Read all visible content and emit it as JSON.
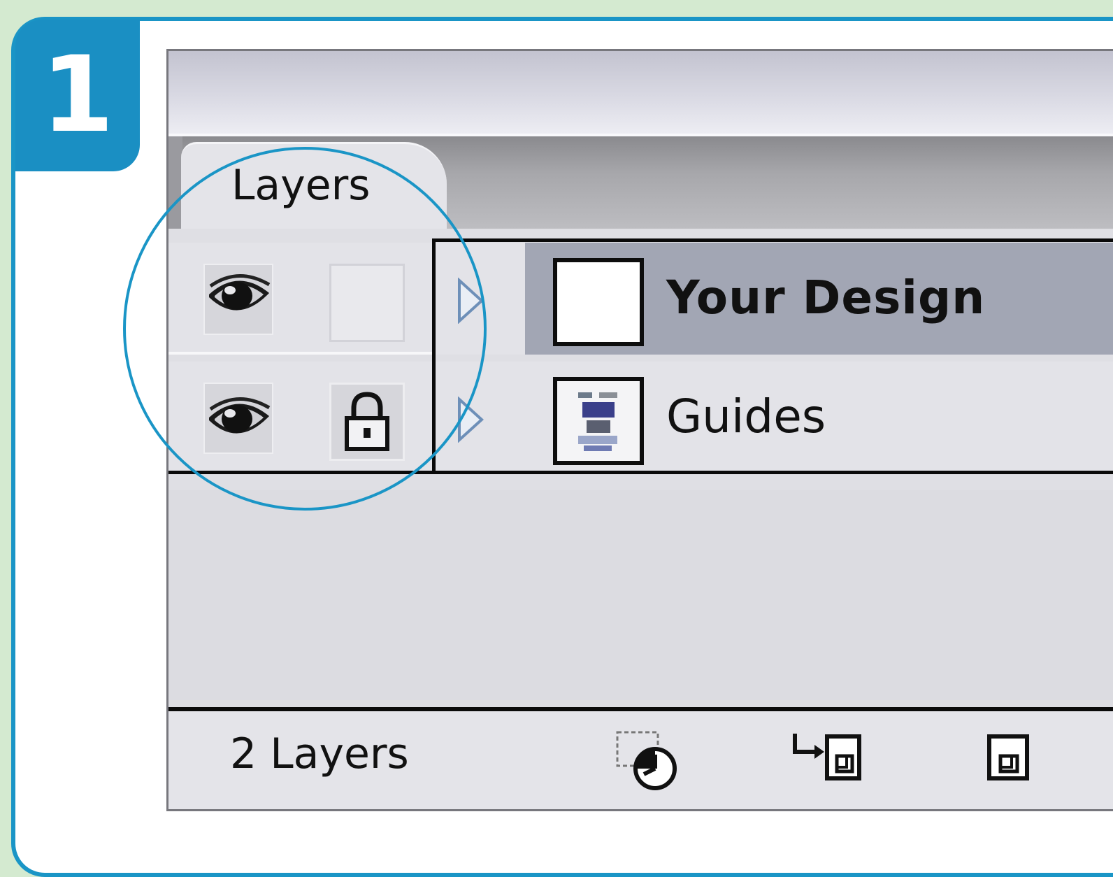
{
  "step": {
    "number": "1"
  },
  "panel": {
    "tab_label": "Layers"
  },
  "layers": [
    {
      "name": "Your Design",
      "visible": true,
      "locked": false,
      "selected": true,
      "visibility_icon": "eye-icon",
      "lock_icon": "empty-lock-slot",
      "thumbnail_icon": "blank-thumbnail"
    },
    {
      "name": "Guides",
      "visible": true,
      "locked": true,
      "selected": false,
      "visibility_icon": "eye-icon",
      "lock_icon": "lock-icon",
      "thumbnail_icon": "guides-thumbnail"
    }
  ],
  "footer": {
    "count_label": "2 Layers",
    "icons": [
      "convert-to-layer-icon",
      "new-sublayer-icon",
      "new-layer-icon"
    ]
  },
  "colors": {
    "accent": "#1a95c6",
    "background": "#d4ead0",
    "selected_row": "#a2a6b4"
  }
}
